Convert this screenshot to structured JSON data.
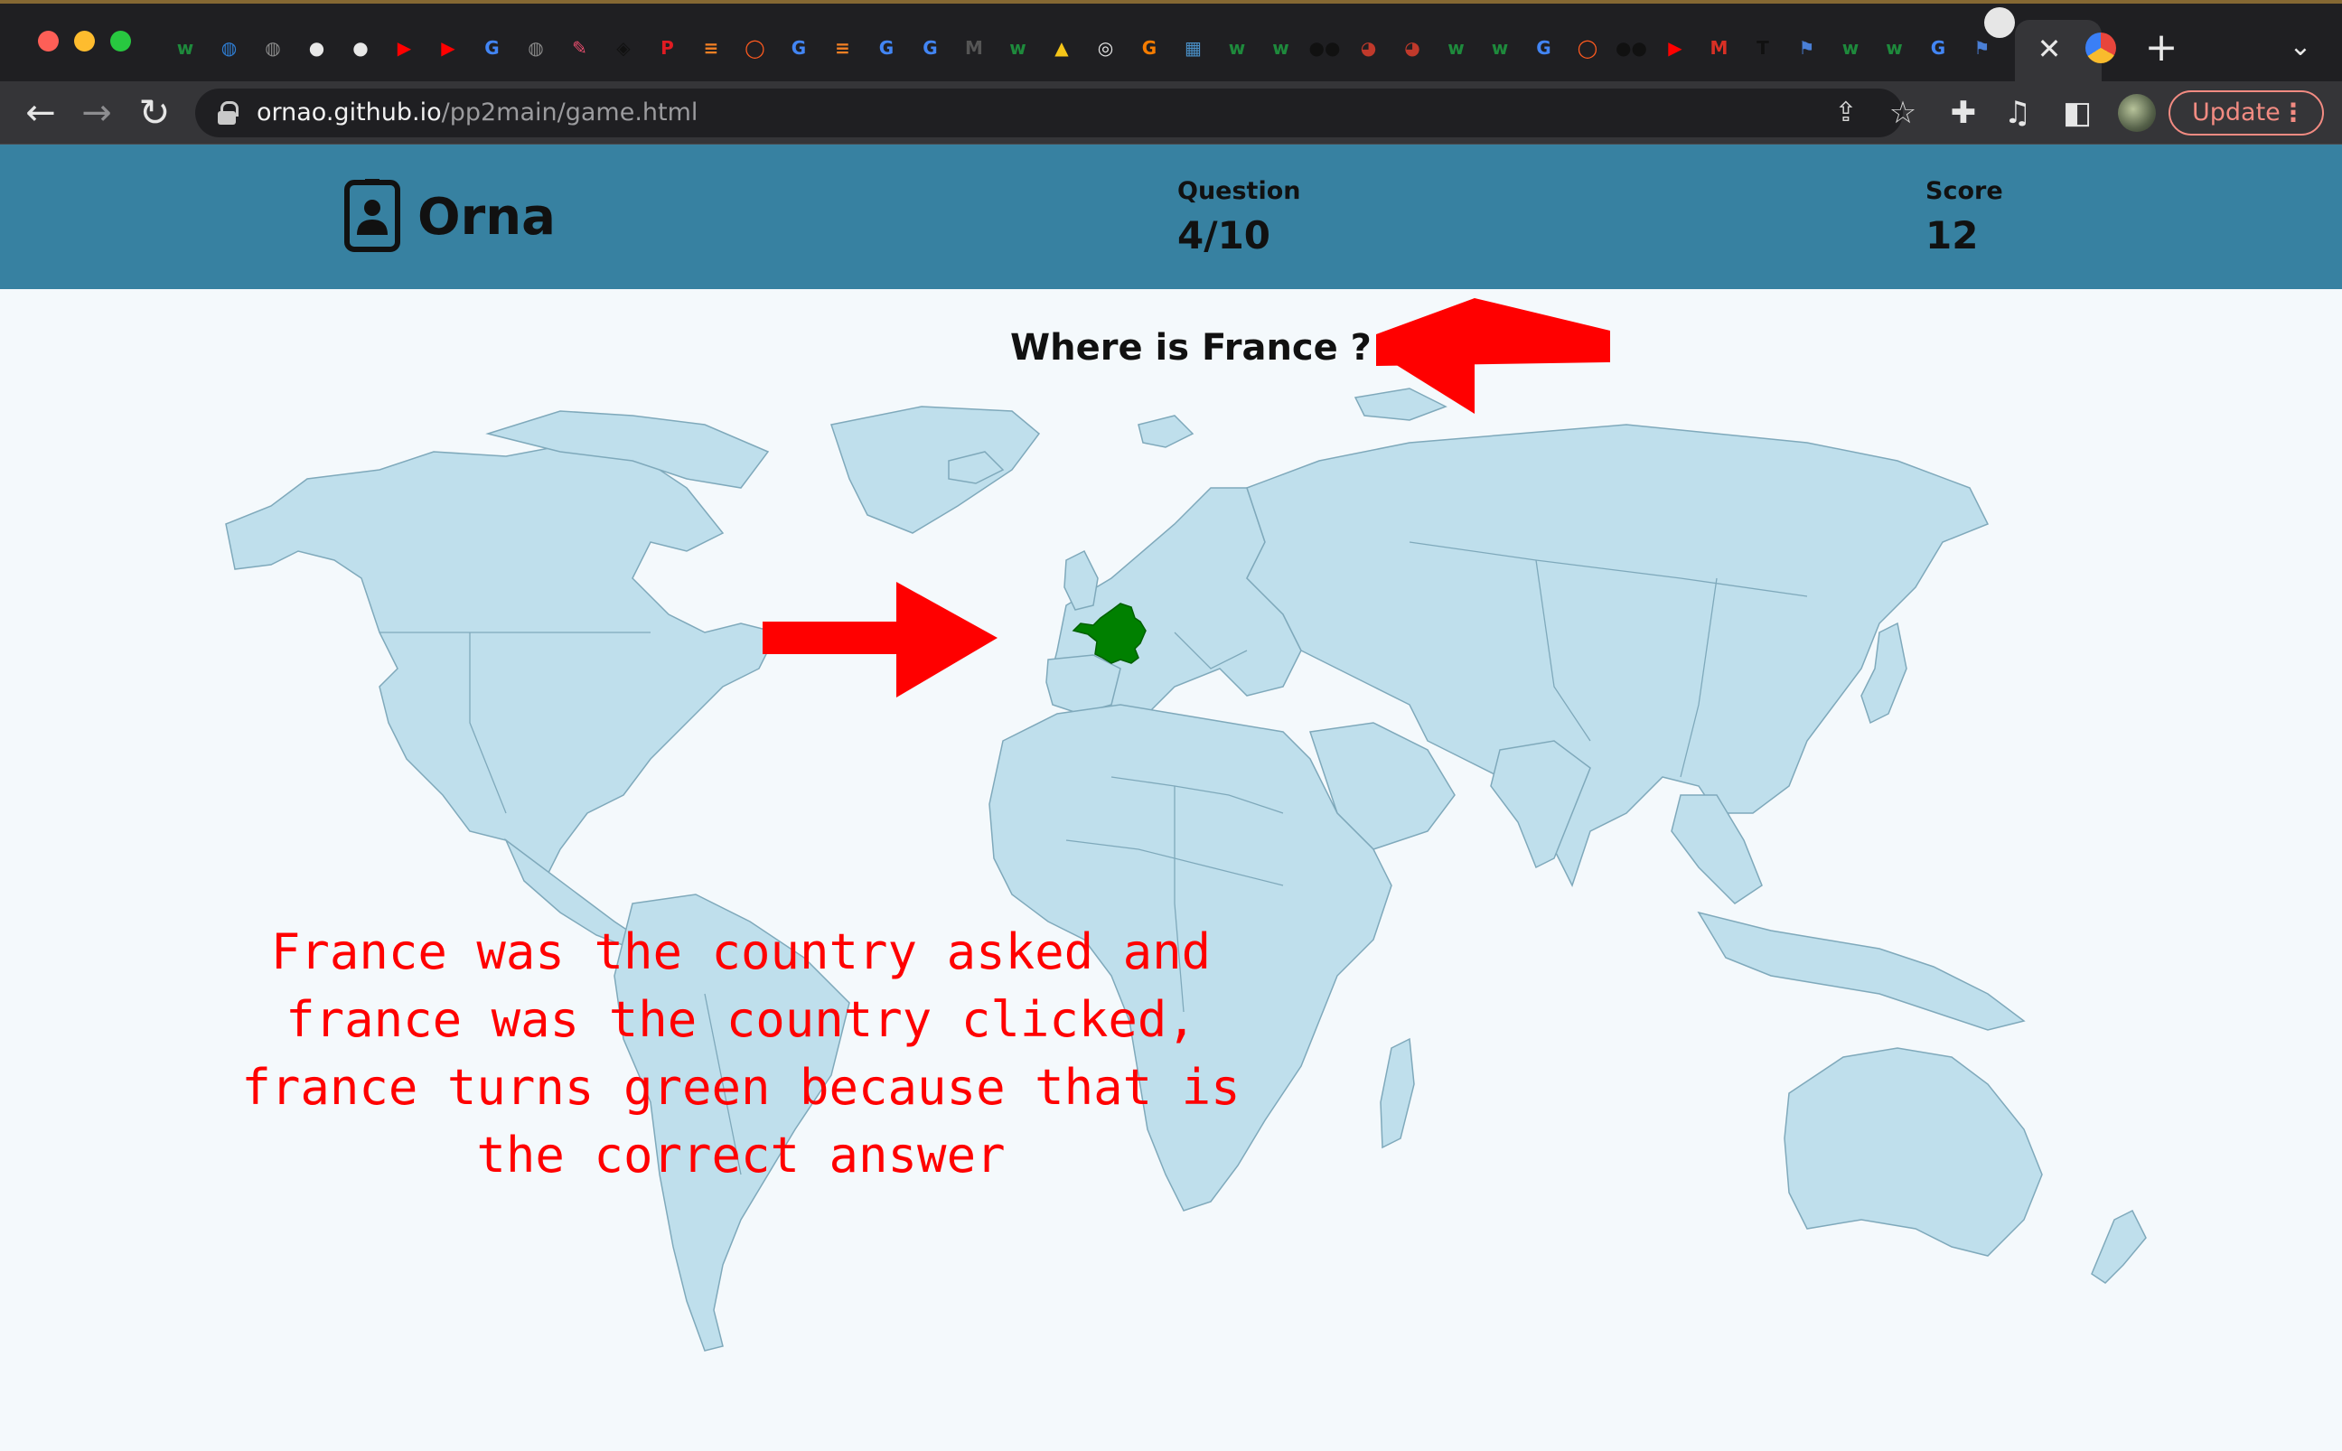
{
  "browser": {
    "url_domain": "ornao.github.io",
    "url_path": "/pp2main/game.html",
    "update_label": "Update",
    "tab_favicons": [
      {
        "icon": "w3schools-icon",
        "glyph": "w",
        "color": "#1e8a3c"
      },
      {
        "icon": "globe-icon",
        "glyph": "◍",
        "color": "#2f7fd6"
      },
      {
        "icon": "globe-icon",
        "glyph": "◍",
        "color": "#8a8a8a"
      },
      {
        "icon": "github-icon",
        "glyph": "●",
        "color": "#e8e8e8"
      },
      {
        "icon": "github-icon",
        "glyph": "●",
        "color": "#e8e8e8"
      },
      {
        "icon": "youtube-icon",
        "glyph": "▶",
        "color": "#ff0000"
      },
      {
        "icon": "youtube-icon",
        "glyph": "▶",
        "color": "#ff0000"
      },
      {
        "icon": "google-icon",
        "glyph": "G",
        "color": "#4285f4"
      },
      {
        "icon": "globe-icon",
        "glyph": "◍",
        "color": "#8a8a8a"
      },
      {
        "icon": "pencil-icon",
        "glyph": "✎",
        "color": "#e94e6e"
      },
      {
        "icon": "codepen-icon",
        "glyph": "◈",
        "color": "#111111"
      },
      {
        "icon": "p-icon",
        "glyph": "P",
        "color": "#e01b22"
      },
      {
        "icon": "stackoverflow-icon",
        "glyph": "≡",
        "color": "#f48024"
      },
      {
        "icon": "ring-icon",
        "glyph": "◯",
        "color": "#ff5a1f"
      },
      {
        "icon": "google-icon",
        "glyph": "G",
        "color": "#4285f4"
      },
      {
        "icon": "stackoverflow-icon",
        "glyph": "≡",
        "color": "#f48024"
      },
      {
        "icon": "google-icon",
        "glyph": "G",
        "color": "#4285f4"
      },
      {
        "icon": "google-icon",
        "glyph": "G",
        "color": "#4285f4"
      },
      {
        "icon": "m-icon",
        "glyph": "M",
        "color": "#555555"
      },
      {
        "icon": "w3schools-icon",
        "glyph": "w",
        "color": "#1e8a3c"
      },
      {
        "icon": "linux-icon",
        "glyph": "▲",
        "color": "#f5c518"
      },
      {
        "icon": "chrome-icon",
        "glyph": "◎",
        "color": "#e8e8e8"
      },
      {
        "icon": "g-icon",
        "glyph": "G",
        "color": "#f57c00"
      },
      {
        "icon": "map-icon",
        "glyph": "▦",
        "color": "#4a90c8"
      },
      {
        "icon": "w3schools-icon",
        "glyph": "w",
        "color": "#1e8a3c"
      },
      {
        "icon": "w3schools-icon",
        "glyph": "w",
        "color": "#1e8a3c"
      },
      {
        "icon": "medium-icon",
        "glyph": "●●",
        "color": "#111111"
      },
      {
        "icon": "colorwheel-icon",
        "glyph": "◕",
        "color": "#c0392b"
      },
      {
        "icon": "colorwheel-icon",
        "glyph": "◕",
        "color": "#c0392b"
      },
      {
        "icon": "w3schools-icon",
        "glyph": "w",
        "color": "#1e8a3c"
      },
      {
        "icon": "w3schools-icon",
        "glyph": "w",
        "color": "#1e8a3c"
      },
      {
        "icon": "google-icon",
        "glyph": "G",
        "color": "#4285f4"
      },
      {
        "icon": "ring-icon",
        "glyph": "◯",
        "color": "#ff5a1f"
      },
      {
        "icon": "medium-icon",
        "glyph": "●●",
        "color": "#111111"
      },
      {
        "icon": "youtube-icon",
        "glyph": "▶",
        "color": "#ff0000"
      },
      {
        "icon": "gmail-icon",
        "glyph": "M",
        "color": "#d93025"
      },
      {
        "icon": "t-icon",
        "glyph": "T",
        "color": "#111111"
      },
      {
        "icon": "flag-icon",
        "glyph": "⚑",
        "color": "#4a7fd6"
      },
      {
        "icon": "w3schools-icon",
        "glyph": "w",
        "color": "#1e8a3c"
      },
      {
        "icon": "w3schools-icon",
        "glyph": "w",
        "color": "#1e8a3c"
      },
      {
        "icon": "google-icon",
        "glyph": "G",
        "color": "#4285f4"
      },
      {
        "icon": "flag-icon",
        "glyph": "⚑",
        "color": "#4a7fd6"
      },
      {
        "icon": "github-icon",
        "glyph": "●",
        "color": "#e8e8e8"
      }
    ]
  },
  "header": {
    "logo_text": "Orna",
    "question_label": "Question",
    "question_value": "4/10",
    "score_label": "Score",
    "score_value": "12"
  },
  "game": {
    "question_text": "Where is France ?",
    "highlighted_country": "France",
    "highlight_color": "#008000"
  },
  "annotation": {
    "color": "#ff0000",
    "lines": [
      "France was the country asked and",
      "france was the country clicked,",
      "france turns green because that is",
      "the correct answer"
    ]
  }
}
